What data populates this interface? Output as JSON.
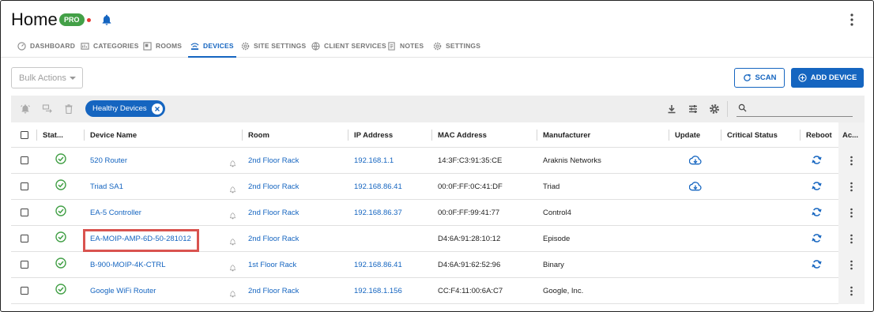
{
  "header": {
    "title": "Home",
    "badge": "PRO"
  },
  "tabs": [
    {
      "label": "DASHBOARD",
      "icon": "dashboard-icon"
    },
    {
      "label": "CATEGORIES",
      "icon": "categories-icon"
    },
    {
      "label": "ROOMS",
      "icon": "rooms-icon"
    },
    {
      "label": "DEVICES",
      "icon": "devices-icon",
      "active": true
    },
    {
      "label": "SITE SETTINGS",
      "icon": "gear-icon"
    },
    {
      "label": "CLIENT SERVICES",
      "icon": "globe-icon"
    },
    {
      "label": "NOTES",
      "icon": "notes-icon"
    },
    {
      "label": "SETTINGS",
      "icon": "gear-icon"
    }
  ],
  "actions": {
    "bulk_actions": "Bulk Actions",
    "scan": "SCAN",
    "add_device": "ADD DEVICE"
  },
  "toolbar": {
    "filter_chip": "Healthy Devices",
    "search_placeholder": ""
  },
  "table": {
    "headers": {
      "status": "Stat...",
      "device_name": "Device Name",
      "room": "Room",
      "ip": "IP Address",
      "mac": "MAC Address",
      "manufacturer": "Manufacturer",
      "update": "Update",
      "critical": "Critical Status",
      "reboot": "Reboot",
      "actions": "Ac..."
    },
    "rows": [
      {
        "name": "520 Router",
        "room": "2nd Floor Rack",
        "ip": "192.168.1.1",
        "mac": "14:3F:C3:91:35:CE",
        "manufacturer": "Araknis Networks",
        "update": true,
        "reboot": true
      },
      {
        "name": "Triad SA1",
        "room": "2nd Floor Rack",
        "ip": "192.168.86.41",
        "mac": "00:0F:FF:0C:41:DF",
        "manufacturer": "Triad",
        "update": true,
        "reboot": true
      },
      {
        "name": "EA-5 Controller",
        "room": "2nd Floor Rack",
        "ip": "192.168.86.37",
        "mac": "00:0F:FF:99:41:77",
        "manufacturer": "Control4",
        "update": false,
        "reboot": true
      },
      {
        "name": "EA-MOIP-AMP-6D-50-281012",
        "room": "2nd Floor Rack",
        "ip": "",
        "mac": "D4:6A:91:28:10:12",
        "manufacturer": "Episode",
        "update": false,
        "reboot": true
      },
      {
        "name": "B-900-MOIP-4K-CTRL",
        "room": "1st Floor Rack",
        "ip": "192.168.86.41",
        "mac": "D4:6A:91:62:52:96",
        "manufacturer": "Binary",
        "update": false,
        "reboot": true
      },
      {
        "name": "Google WiFi Router",
        "room": "2nd Floor Rack",
        "ip": "192.168.1.156",
        "mac": "CC:F4:11:00:6A:C7",
        "manufacturer": "Google, Inc.",
        "update": false,
        "reboot": false
      }
    ]
  },
  "colors": {
    "primary": "#1565c0",
    "success": "#43a047",
    "alert": "#e53935",
    "highlight": "#d9534f"
  }
}
